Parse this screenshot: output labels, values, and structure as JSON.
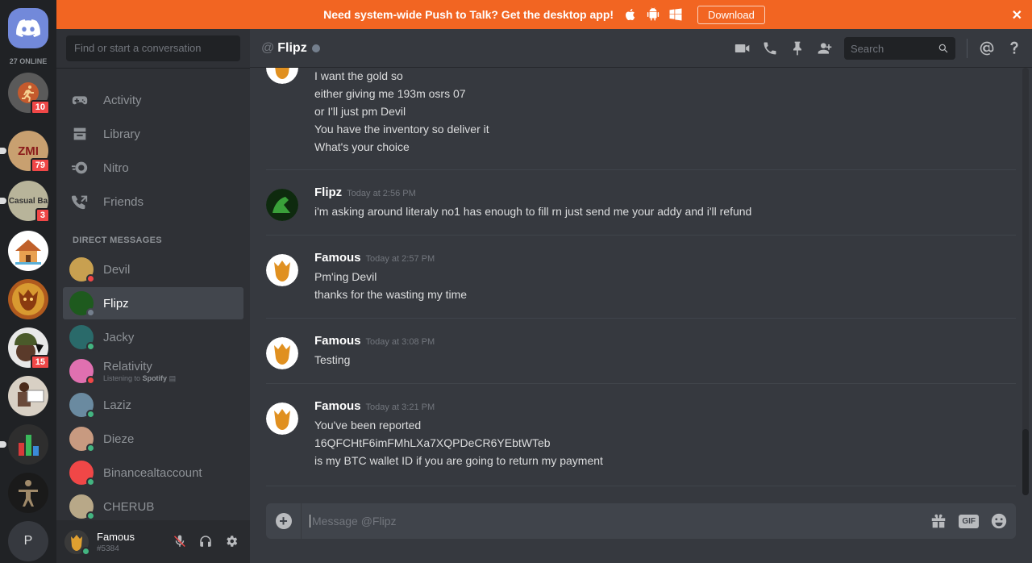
{
  "banner": {
    "text": "Need system-wide Push to Talk? Get the desktop app!",
    "download_label": "Download",
    "close_glyph": "✕"
  },
  "guilds": {
    "online_count": "27 ONLINE",
    "items": [
      {
        "initials": "",
        "badge": "10",
        "color": "#c45a2d",
        "icon": "runner-icon"
      },
      {
        "initials": "ZMI",
        "badge": "79",
        "color": "#c8a070",
        "icon": "zmi-icon"
      },
      {
        "initials": "Casual Ba",
        "badge": "3",
        "color": "#b8b49a",
        "icon": "casual-icon"
      },
      {
        "initials": "",
        "badge": "",
        "color": "#e6a050",
        "icon": "hut-icon"
      },
      {
        "initials": "",
        "badge": "",
        "color": "#b05a1e",
        "icon": "creature-icon"
      },
      {
        "initials": "",
        "badge": "15",
        "color": "#e8e8e8",
        "icon": "soldier-icon"
      },
      {
        "initials": "",
        "badge": "",
        "color": "#d8d0c4",
        "icon": "person-icon"
      },
      {
        "initials": "",
        "badge": "",
        "color": "#2e2e2e",
        "icon": "chart-icon"
      },
      {
        "initials": "",
        "badge": "",
        "color": "#1a1a1a",
        "icon": "figure-icon"
      },
      {
        "initials": "P",
        "badge": "",
        "color": "#36393f",
        "icon": "letter-icon"
      }
    ]
  },
  "sidebar": {
    "search_placeholder": "Find or start a conversation",
    "nav": [
      "Activity",
      "Library",
      "Nitro",
      "Friends"
    ],
    "dm_header": "DIRECT MESSAGES",
    "dms": [
      {
        "name": "Devil",
        "status": "#f04747",
        "avatar": "#c8a050",
        "sub": ""
      },
      {
        "name": "Flipz",
        "status": "#747f8d",
        "avatar": "#1e5a1e",
        "sub": ""
      },
      {
        "name": "Jacky",
        "status": "#43b581",
        "avatar": "#2a6a6a",
        "sub": ""
      },
      {
        "name": "Relativity",
        "status": "#f04747",
        "avatar": "#e070b0",
        "sub_prefix": "Listening to",
        "sub_app": "Spotify"
      },
      {
        "name": "Laziz",
        "status": "#43b581",
        "avatar": "#6a8aa0",
        "sub": ""
      },
      {
        "name": "Dieze",
        "status": "#43b581",
        "avatar": "#c89a80",
        "sub": ""
      },
      {
        "name": "Binancealtaccount",
        "status": "#43b581",
        "avatar": "#f04747",
        "sub": ""
      },
      {
        "name": "CHERUB",
        "status": "#43b581",
        "avatar": "#b8a888",
        "sub": ""
      }
    ]
  },
  "user": {
    "name": "Famous",
    "tag": "#5384"
  },
  "chat": {
    "at": "@",
    "recipient": "Flipz",
    "search_placeholder": "Search",
    "input_placeholder": "Message @Flipz"
  },
  "messages": [
    {
      "author": "",
      "time": "",
      "avatar": "famous",
      "lines": [
        "I want the gold so",
        "either giving me 193m osrs 07",
        "or I'll just pm Devil",
        "You have the inventory so deliver it",
        "What's your choice"
      ]
    },
    {
      "author": "Flipz",
      "time": "Today at 2:56 PM",
      "avatar": "flipz",
      "lines": [
        "i'm asking around literaly no1 has enough to fill rn just send me your addy and i'll refund"
      ]
    },
    {
      "author": "Famous",
      "time": "Today at 2:57 PM",
      "avatar": "famous",
      "lines": [
        "Pm'ing Devil",
        "thanks for the wasting my time"
      ]
    },
    {
      "author": "Famous",
      "time": "Today at 3:08 PM",
      "avatar": "famous",
      "lines": [
        "Testing"
      ]
    },
    {
      "author": "Famous",
      "time": "Today at 3:21 PM",
      "avatar": "famous",
      "lines": [
        "You've been reported",
        "16QFCHtF6imFMhLXa7XQPDeCR6YEbtWTeb",
        "is my BTC wallet ID if you are going to return my payment"
      ]
    }
  ],
  "composer": {
    "plus_glyph": "+",
    "gif_label": "GIF"
  }
}
